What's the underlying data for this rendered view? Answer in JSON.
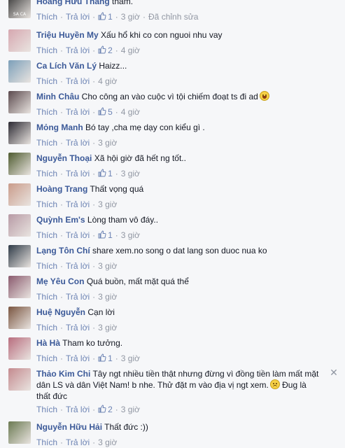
{
  "labels": {
    "like": "Thích",
    "reply": "Trả lời",
    "edited": "Đã chỉnh sửa"
  },
  "comments": [
    {
      "name": "Hoàng Hữu Thắng",
      "text": "thảm.",
      "likes": "1",
      "time": "3 giờ",
      "edited": true,
      "avatar": "#3a3a3a",
      "avatar_tag": "SA CA"
    },
    {
      "name": "Triệu Huyền My",
      "text": "Xấu hổ khi co con nguoi nhu vay",
      "likes": "2",
      "time": "4 giờ",
      "avatar": "#d6a7b0"
    },
    {
      "name": "Ca Lích Văn Lý",
      "text": "Haizz...",
      "likes": "",
      "time": "4 giờ",
      "avatar": "#7c9fb9"
    },
    {
      "name": "Minh Châu",
      "text": "Cho công an vào cuộc vì tội chiếm đoạt ts đi ad",
      "likes": "5",
      "time": "4 giờ",
      "emoji": "laugh",
      "avatar": "#5b4a4e"
    },
    {
      "name": "Mỏng Manh",
      "text": "Bó tay ,cha mẹ dạy con kiểu gì .",
      "likes": "",
      "time": "3 giờ",
      "avatar": "#2c2a33"
    },
    {
      "name": "Nguyễn Thoại",
      "text": "Xã hội giờ đã hết ng tốt..",
      "likes": "1",
      "time": "3 giờ",
      "avatar": "#4e5b2f"
    },
    {
      "name": "Hoàng Trang",
      "text": "Thất vọng quá",
      "likes": "",
      "time": "3 giờ",
      "avatar": "#c99b8a"
    },
    {
      "name": "Quỳnh Em's",
      "text": "Lòng tham vô đáy..",
      "likes": "1",
      "time": "3 giờ",
      "avatar": "#b79aa5"
    },
    {
      "name": "Lạng Tôn Chí",
      "text": "share xem.no song o dat lang son duoc nua ko",
      "likes": "",
      "time": "3 giờ",
      "avatar": "#2e3a47"
    },
    {
      "name": "Mẹ Yêu Con",
      "text": "Quá buồn, mất mặt quá thể",
      "likes": "",
      "time": "3 giờ",
      "avatar": "#8a5a6e"
    },
    {
      "name": "Huệ Nguyễn",
      "text": "Cạn lời",
      "likes": "",
      "time": "3 giờ",
      "avatar": "#7a5540"
    },
    {
      "name": "Hà Hà",
      "text": "Tham ko tưởng.",
      "likes": "1",
      "time": "3 giờ",
      "avatar": "#b86d7e"
    },
    {
      "name": "Thảo Kim Chi",
      "text": "Tây ngt nhiều tiền thật nhưng đừng vì đồng tiền làm mất mặt dân LS và dân Việt Nam! b nhe. Thử đặt m vào địa vị ngt xem.",
      "text2": "Đug là thất đức",
      "likes": "2",
      "time": "3 giờ",
      "emoji": "sad",
      "closable": true,
      "avatar": "#c48a8f"
    },
    {
      "name": "Nguyễn Hữu Hải",
      "text": "Thất đức :))",
      "likes": "",
      "time": "3 giờ",
      "avatar": "#6b7a52"
    }
  ]
}
